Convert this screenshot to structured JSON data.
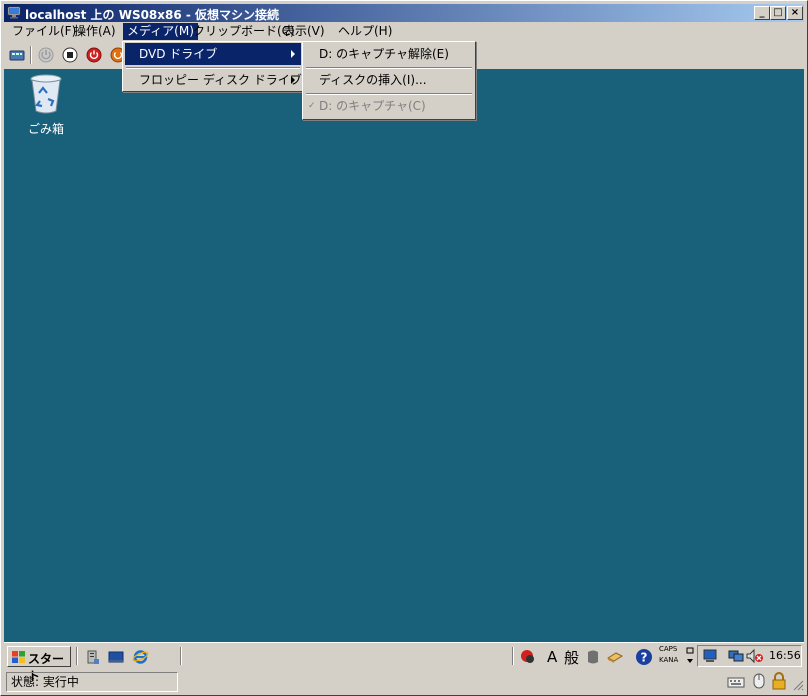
{
  "window": {
    "title": "localhost 上の WS08x86 - 仮想マシン接続",
    "min_label": "_",
    "max_label": "□",
    "close_label": "×"
  },
  "menubar": {
    "items": [
      {
        "label": "ファイル(F)"
      },
      {
        "label": "操作(A)"
      },
      {
        "label": "メディア(M)"
      },
      {
        "label": "クリップボード(C)"
      },
      {
        "label": "表示(V)"
      },
      {
        "label": "ヘルプ(H)"
      }
    ]
  },
  "media_menu": {
    "items": [
      {
        "label": "DVD ドライブ"
      },
      {
        "label": "フロッピー ディスク ドライブ"
      }
    ]
  },
  "dvd_submenu": {
    "items": [
      {
        "label": "D: のキャプチャ解除(E)"
      },
      {
        "label": "ディスクの挿入(I)..."
      },
      {
        "label": "D: のキャプチャ(C)"
      }
    ],
    "checkmark": "✓"
  },
  "desktop": {
    "recycle_bin_label": "ごみ箱"
  },
  "taskbar": {
    "start_label": "スタート",
    "ime_a": "A",
    "ime_mode": "般",
    "help_glyph": "?",
    "caps": "CAPS",
    "kana": "KANA",
    "clock": "16:56"
  },
  "status": {
    "text": "状態: 実行中"
  },
  "colors": {
    "desktop": "#19607b",
    "highlight": "#0a246a"
  }
}
